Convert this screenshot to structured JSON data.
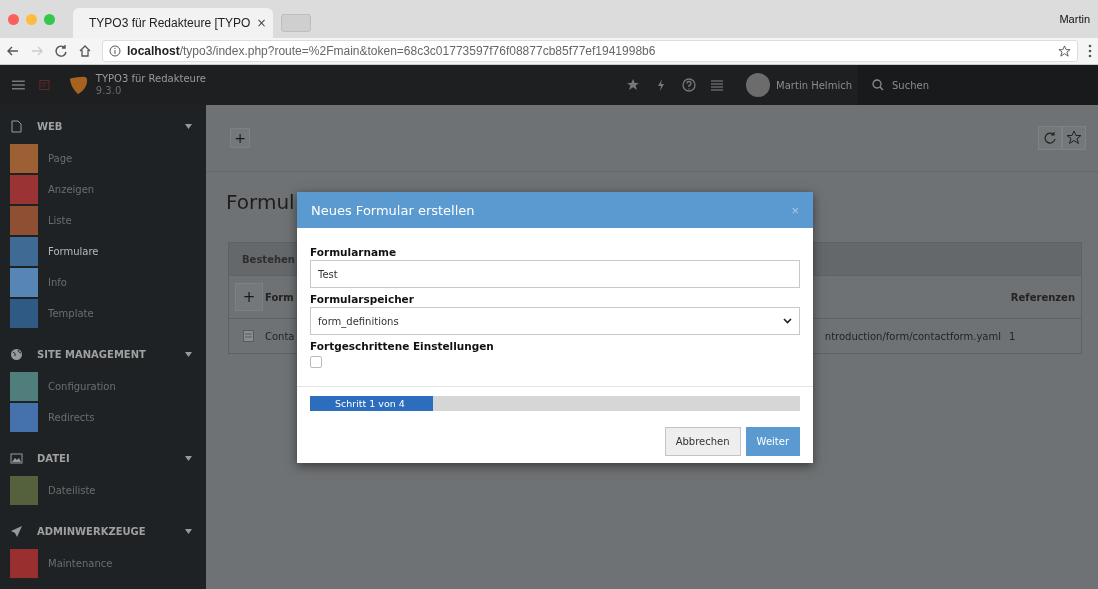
{
  "browser": {
    "tab_title": "TYPO3 für Redakteure [TYPO",
    "tab_close": "×",
    "profile": "Martin",
    "url": "**localhost**/typo3/index.php?route=%2Fmain&token=68c3c01773597f76f08877cb85f77ef1941998b6"
  },
  "topbar": {
    "site_name": "TYPO3 für Redakteure",
    "version": "9.3.0",
    "user": "Martin Helmich",
    "search": "Suchen"
  },
  "sidebar": {
    "groups": [
      {
        "title": "WEB",
        "expanded": true,
        "items": [
          {
            "label": "Page",
            "color": "#9c6034",
            "selected": false
          },
          {
            "label": "Anzeigen",
            "color": "#9a3434",
            "selected": false
          },
          {
            "label": "Liste",
            "color": "#8f4f33",
            "selected": false
          },
          {
            "label": "Formulare",
            "color": "#3f6a94",
            "selected": true
          },
          {
            "label": "Info",
            "color": "#5785b4",
            "selected": false
          },
          {
            "label": "Template",
            "color": "#2f5a84",
            "selected": false
          }
        ]
      },
      {
        "title": "SITE MANAGEMENT",
        "expanded": true,
        "items": [
          {
            "label": "Configuration",
            "color": "#4f7e7c",
            "selected": false
          },
          {
            "label": "Redirects",
            "color": "#4571ad",
            "selected": false
          }
        ]
      },
      {
        "title": "DATEI",
        "expanded": true,
        "items": [
          {
            "label": "Dateiliste",
            "color": "#55613d",
            "selected": false
          }
        ]
      },
      {
        "title": "ADMINWERKZEUGE",
        "expanded": true,
        "items": [
          {
            "label": "Maintenance",
            "color": "#9a2f2f",
            "selected": false
          }
        ]
      }
    ]
  },
  "docheader": {
    "add": "+"
  },
  "content": {
    "title": "Formul",
    "panel": {
      "header": "Bestehen",
      "add": "+",
      "columns": [
        "Form",
        "Referenzen"
      ],
      "rows": [
        {
          "name": "Conta",
          "path": "ntroduction/form/contactform.yaml",
          "references": "1"
        }
      ]
    }
  },
  "dialog": {
    "title": "Neues Formular erstellen",
    "close": "×",
    "fields": [
      {
        "kind": "text",
        "label": "Formularname",
        "value": "Test"
      },
      {
        "kind": "select",
        "label": "Formularspeicher",
        "value": "form_definitions"
      },
      {
        "kind": "checkbox",
        "label": "Fortgeschrittene Einstellungen",
        "checked": false
      }
    ],
    "progress": {
      "label": "Schritt 1 von 4",
      "level": 0.25
    },
    "buttons": [
      {
        "label": "Abbrechen",
        "kind": "default"
      },
      {
        "label": "Weiter",
        "kind": "primary"
      }
    ]
  }
}
